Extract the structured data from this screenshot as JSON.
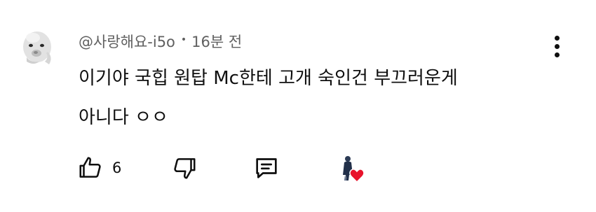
{
  "comment": {
    "author": "@사랑해요-i5o",
    "separator": "•",
    "timestamp": "16분 전",
    "text": "이기야 국힙 원탑 Mc한테 고개 숙인건 부끄러운게\n아니다 ㅇㅇ",
    "like_count": "6"
  },
  "icons": {
    "avatar": "baby-face-avatar",
    "menu": "more-vertical-icon",
    "like": "thumbs-up-icon",
    "dislike": "thumbs-down-icon",
    "reply": "reply-comment-icon",
    "creator_heart": "creator-heart-badge"
  },
  "colors": {
    "primary_text": "#0f0f0f",
    "secondary_text": "#606060",
    "heart": "#e8132b"
  }
}
